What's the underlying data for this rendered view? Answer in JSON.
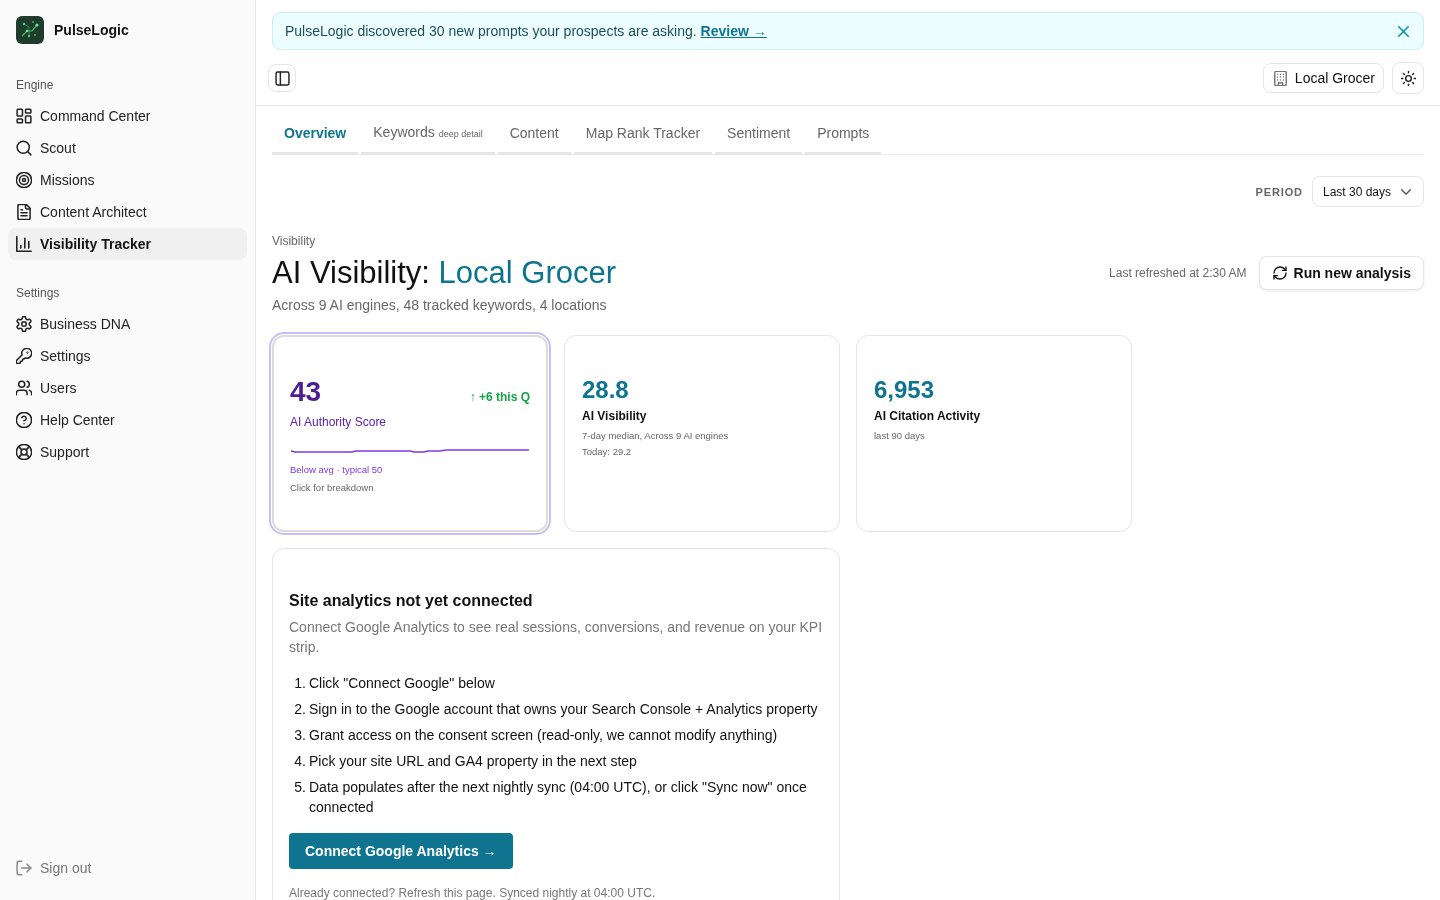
{
  "sidebar": {
    "brand": "PulseLogic",
    "sections": [
      {
        "heading": "Engine",
        "items": [
          {
            "label": "Command Center",
            "selected": false
          },
          {
            "label": "Scout",
            "selected": false
          },
          {
            "label": "Missions",
            "selected": false
          },
          {
            "label": "Content Architect",
            "selected": false
          },
          {
            "label": "Visibility Tracker",
            "selected": true
          }
        ]
      },
      {
        "heading": "Settings",
        "items": [
          {
            "label": "Business DNA",
            "selected": false
          },
          {
            "label": "Settings",
            "selected": false
          },
          {
            "label": "Users",
            "selected": false
          },
          {
            "label": "Help Center",
            "selected": false
          },
          {
            "label": "Support",
            "selected": false
          }
        ]
      }
    ],
    "sign_out": "Sign out"
  },
  "banner": {
    "message": "PulseLogic discovered 30 new prompts your prospects are asking.",
    "link": "Review →"
  },
  "header": {
    "business": "Local Grocer"
  },
  "tabs": [
    {
      "label": "Overview",
      "selected": true
    },
    {
      "label": "Keywords",
      "note": "deep detail",
      "selected": false
    },
    {
      "label": "Content",
      "selected": false
    },
    {
      "label": "Map Rank Tracker",
      "selected": false
    },
    {
      "label": "Sentiment",
      "selected": false
    },
    {
      "label": "Prompts",
      "selected": false
    }
  ],
  "period": {
    "label": "PERIOD",
    "value": "Last 30 days"
  },
  "page": {
    "eyebrow": "Visibility",
    "title": "AI Visibility:",
    "title_accent": "Local Grocer",
    "subtitle": "Across 9 AI engines, 48 tracked keywords, 4 locations",
    "refreshed": "Last refreshed at 2:30 AM",
    "action": "Run new analysis"
  },
  "metrics": [
    {
      "kind": "score",
      "value": "43",
      "label": "AI Authority Score",
      "delta": "↑ +6 this Q",
      "benchmark": "Below avg · typical 50",
      "hint": "Click for breakdown",
      "selected": true
    },
    {
      "kind": "stat",
      "value": "28.8",
      "label": "AI Visibility",
      "details": [
        "7-day median, Across 9 AI engines",
        "Today: 29.2"
      ],
      "selected": false
    },
    {
      "kind": "stat",
      "value": "6,953",
      "label": "AI Citation Activity",
      "details": [
        "last 90 days"
      ],
      "selected": false
    }
  ],
  "analytics_card": {
    "title": "Site analytics not yet connected",
    "description": "Connect Google Analytics to see real sessions, conversions, and revenue on your KPI strip.",
    "steps": [
      {
        "number": "1.",
        "text": "Click \"Connect Google\" below"
      },
      {
        "number": "2.",
        "text": "Sign in to the Google account that owns your Search Console + Analytics property"
      },
      {
        "number": "3.",
        "text": "Grant access on the consent screen (read-only, we cannot modify anything)"
      },
      {
        "number": "4.",
        "text": "Pick your site URL and GA4 property in the next step"
      },
      {
        "number": "5.",
        "text": "Data populates after the next nightly sync (04:00 UTC), or click \"Sync now\" once connected"
      }
    ],
    "button": "Connect Google Analytics →",
    "footer": "Already connected? Refresh this page. Synced nightly at 04:00 UTC."
  }
}
